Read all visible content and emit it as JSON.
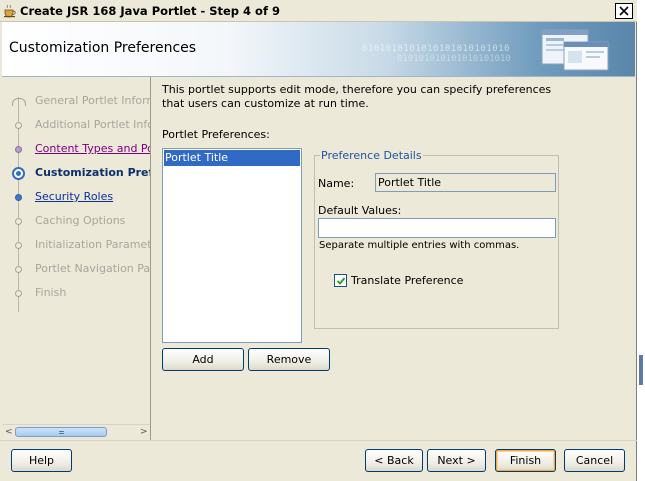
{
  "window": {
    "title": "Create JSR 168 Java Portlet - Step 4 of 9",
    "close_glyph": "✕"
  },
  "header": {
    "heading": "Customization Preferences",
    "binary_text_1": "0101010101010101010101010",
    "binary_text_2": "010101010101010101010"
  },
  "nav": {
    "items": [
      {
        "label": "General Portlet Informati",
        "state": "disabled"
      },
      {
        "label": "Additional Portlet Inform",
        "state": "disabled"
      },
      {
        "label": "Content Types and Port",
        "state": "visited"
      },
      {
        "label": "Customization Prefe",
        "state": "current"
      },
      {
        "label": "Security Roles",
        "state": "link"
      },
      {
        "label": "Caching Options",
        "state": "disabled"
      },
      {
        "label": "Initialization Parameters",
        "state": "disabled"
      },
      {
        "label": "Portlet Navigation Paran",
        "state": "disabled"
      },
      {
        "label": "Finish",
        "state": "disabled"
      }
    ],
    "scroll_left": "<",
    "scroll_right": ">"
  },
  "main": {
    "description": "This portlet supports edit mode, therefore you can specify preferences that users can customize at run time.",
    "preferences_label": "Portlet Preferences:",
    "preferences": [
      "Portlet Title"
    ],
    "add_label": "Add",
    "remove_label": "Remove"
  },
  "details": {
    "legend": "Preference Details",
    "name_label": "Name:",
    "name_value": "Portlet Title",
    "default_label": "Default Values:",
    "default_value": "",
    "hint": "Separate multiple entries with commas.",
    "translate_label": "Translate Preference",
    "translate_checked": true
  },
  "footer": {
    "help_label": "Help",
    "back_label": "< Back",
    "next_label": "Next >",
    "finish_label": "Finish",
    "cancel_label": "Cancel"
  }
}
